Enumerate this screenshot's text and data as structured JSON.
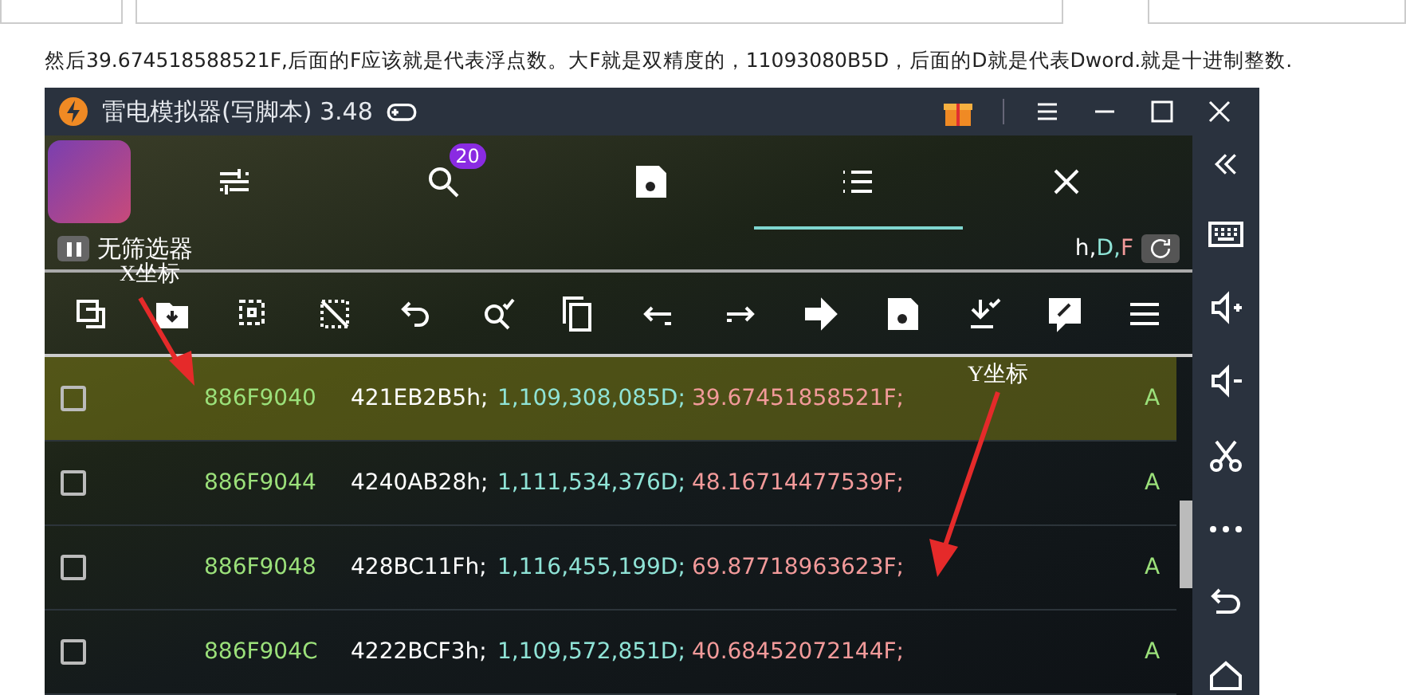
{
  "paragraph": "然后39.674518588521F,后面的F应该就是代表浮点数。大F就是双精度的，11093080B5D，后面的D就是代表Dword.就是十进制整数.",
  "window": {
    "title": "雷电模拟器(写脚本) 3.48"
  },
  "overlay": {
    "badge": "20",
    "filter_label": "无筛选器",
    "filter_paused": true,
    "type_filter": [
      {
        "text": "h,",
        "color": "#ffffff"
      },
      {
        "text": "D,",
        "color": "#8fe3d6"
      },
      {
        "text": "F",
        "color": "#f29a9a"
      }
    ]
  },
  "rows": [
    {
      "checked": false,
      "selected": true,
      "address": "886F9040",
      "hex": "421EB2B5h;",
      "dword": "1,109,308,085D;",
      "float": "39.67451858521F;",
      "column_5": "A"
    },
    {
      "checked": false,
      "selected": false,
      "address": "886F9044",
      "hex": "4240AB28h;",
      "dword": "1,111,534,376D;",
      "float": "48.16714477539F;",
      "column_5": "A"
    },
    {
      "checked": false,
      "selected": false,
      "address": "886F9048",
      "hex": "428BC11Fh;",
      "dword": "1,116,455,199D;",
      "float": "69.87718963623F;",
      "column_5": "A"
    },
    {
      "checked": false,
      "selected": false,
      "address": "886F904C",
      "hex": "4222BCF3h;",
      "dword": "1,109,572,851D;",
      "float": "40.68452072144F;",
      "column_5": "A"
    }
  ],
  "annotations": [
    {
      "label": "X坐标"
    },
    {
      "label": "Y坐标"
    }
  ]
}
